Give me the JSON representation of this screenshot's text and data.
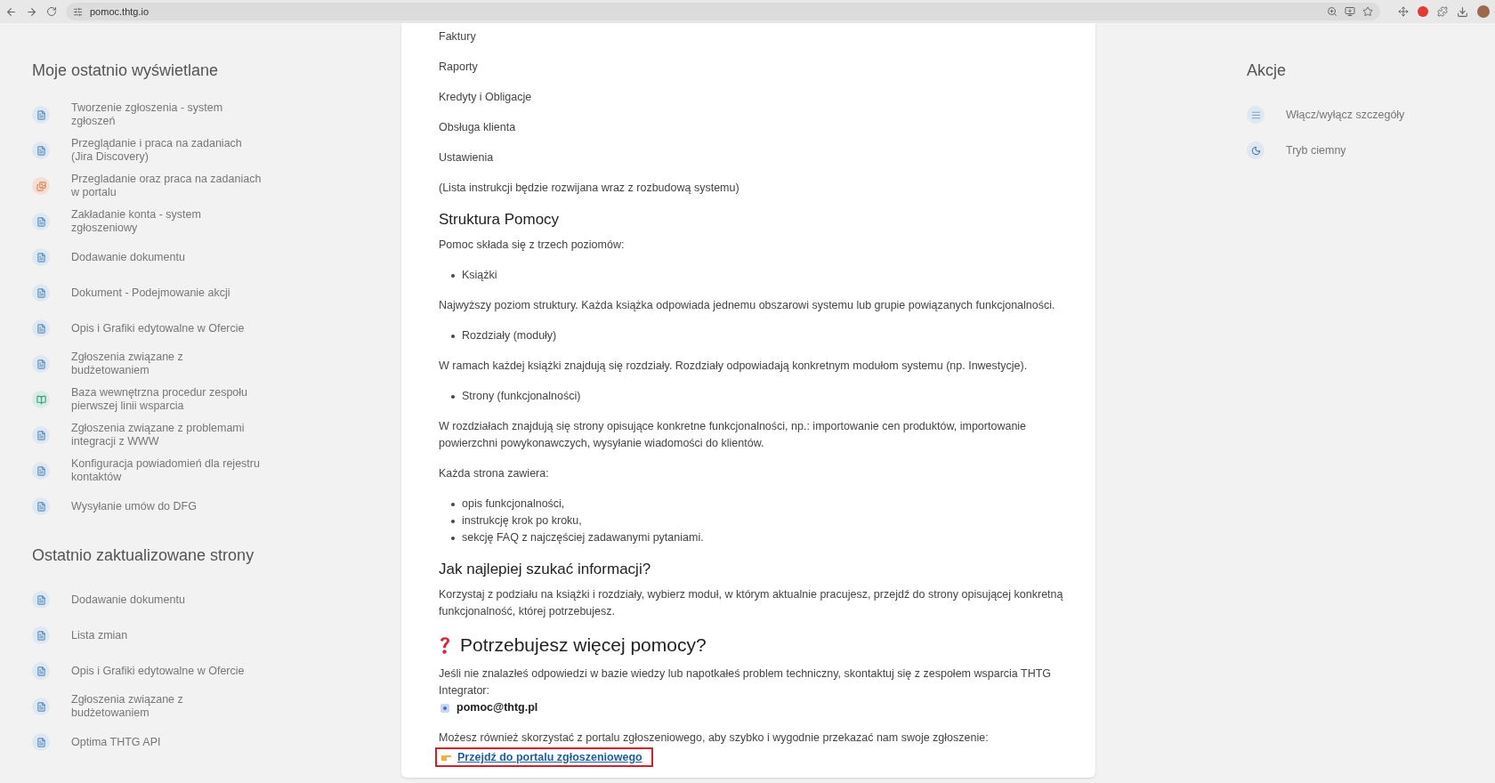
{
  "browser": {
    "url": "pomoc.thtg.io"
  },
  "recent": {
    "title": "Moje ostatnio wyświetlane",
    "items": [
      {
        "kind": "page",
        "label": "Tworzenie zgłoszenia - system zgłoszeń"
      },
      {
        "kind": "page",
        "label": "Przeglądanie i praca na zadaniach (Jira Discovery)"
      },
      {
        "kind": "draw",
        "label": "Przegladanie oraz praca na zadaniach w portalu"
      },
      {
        "kind": "page",
        "label": "Zakładanie konta - system zgłoszeniowy"
      },
      {
        "kind": "page",
        "label": "Dodawanie dokumentu"
      },
      {
        "kind": "page",
        "label": "Dokument - Podejmowanie akcji"
      },
      {
        "kind": "page",
        "label": "Opis i Grafiki edytowalne w Ofercie"
      },
      {
        "kind": "page",
        "label": "Zgłoszenia związane z budżetowaniem"
      },
      {
        "kind": "book",
        "label": "Baza wewnętrzna procedur zespołu pierwszej linii wsparcia"
      },
      {
        "kind": "page",
        "label": "Zgłoszenia związane z problemami integracji z WWW"
      },
      {
        "kind": "page",
        "label": "Konfiguracja powiadomień dla rejestru kontaktów"
      },
      {
        "kind": "page",
        "label": "Wysyłanie umów do DFG"
      }
    ]
  },
  "updated": {
    "title": "Ostatnio zaktualizowane strony",
    "items": [
      {
        "kind": "page",
        "label": "Dodawanie dokumentu"
      },
      {
        "kind": "page",
        "label": "Lista zmian"
      },
      {
        "kind": "page",
        "label": "Opis i Grafiki edytowalne w Ofercie"
      },
      {
        "kind": "page",
        "label": "Zgłoszenia związane z budżetowaniem"
      },
      {
        "kind": "page",
        "label": "Optima THTG API"
      }
    ]
  },
  "content": [
    {
      "kind": "paragraph",
      "text": "Faktury"
    },
    {
      "kind": "paragraph",
      "text": "Raporty"
    },
    {
      "kind": "paragraph",
      "text": "Kredyty i Obligacje"
    },
    {
      "kind": "paragraph",
      "text": "Obsługa klienta"
    },
    {
      "kind": "paragraph",
      "text": "Ustawienia"
    },
    {
      "kind": "paragraph",
      "text": "(Lista instrukcji będzie rozwijana wraz z rozbudową systemu)"
    },
    {
      "kind": "heading",
      "text": "Struktura Pomocy"
    },
    {
      "kind": "paragraph",
      "text": "Pomoc składa się z trzech poziomów:"
    },
    {
      "kind": "bullets",
      "items": [
        "Książki"
      ]
    },
    {
      "kind": "paragraph",
      "text": "Najwyższy poziom struktury. Każda książka odpowiada jednemu obszarowi systemu lub grupie powiązanych funkcjonalności."
    },
    {
      "kind": "bullets",
      "items": [
        "Rozdziały (moduły)"
      ]
    },
    {
      "kind": "paragraph",
      "text": "W ramach każdej książki znajdują się rozdziały. Rozdziały odpowiadają konkretnym modułom systemu (np. Inwestycje)."
    },
    {
      "kind": "bullets",
      "items": [
        "Strony (funkcjonalności)"
      ]
    },
    {
      "kind": "paragraph",
      "text": "W rozdziałach znajdują się strony opisujące konkretne funkcjonalności, np.: importowanie cen produktów, importowanie powierzchni powykonawczych, wysyłanie wiadomości do klientów."
    },
    {
      "kind": "paragraph",
      "text": "Każda strona zawiera:"
    },
    {
      "kind": "bullets",
      "items": [
        "opis funkcjonalności,",
        "instrukcję krok po kroku,",
        "sekcję FAQ z najczęściej zadawanymi pytaniami."
      ]
    },
    {
      "kind": "heading",
      "text": "Jak najlepiej szukać informacji?"
    },
    {
      "kind": "paragraph",
      "text": "Korzystaj z podziału na książki i rozdziały, wybierz moduł, w którym aktualnie pracujesz, przejdź do strony opisującej konkretną funkcjonalność, której potrzebujesz."
    },
    {
      "kind": "big_heading",
      "text": "Potrzebujesz więcej pomocy?"
    },
    {
      "kind": "contact",
      "text": "Jeśli nie znalazłeś odpowiedzi w bazie wiedzy lub napotkałeś problem techniczny, skontaktuj się z zespołem wsparcia THTG Integrator:",
      "email": "pomoc@thtg.pl"
    },
    {
      "kind": "portal",
      "text": "Możesz również skorzystać z portalu zgłoszeniowego, aby szybko i wygodnie przekazać nam swoje zgłoszenie:",
      "link": "Przejdź do portalu zgłoszeniowego",
      "highlighted": true
    }
  ],
  "actions": {
    "title": "Akcje",
    "items": [
      {
        "kind": "details",
        "label": "Włącz/wyłącz szczegóły"
      },
      {
        "kind": "dark",
        "label": "Tryb ciemny"
      }
    ]
  }
}
